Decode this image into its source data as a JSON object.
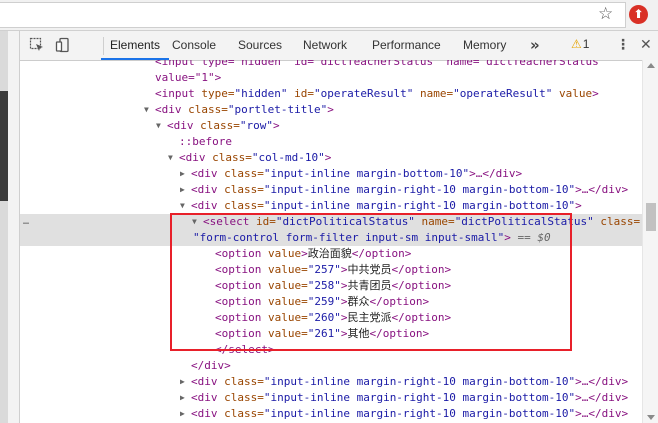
{
  "browser": {
    "star_icon": "star-icon",
    "extension_badge": "⬆"
  },
  "devtools": {
    "tabs": [
      {
        "label": "Elements",
        "active": true
      },
      {
        "label": "Console"
      },
      {
        "label": "Sources"
      },
      {
        "label": "Network"
      },
      {
        "label": "Performance"
      },
      {
        "label": "Memory"
      }
    ],
    "more_tabs": "»",
    "warning_count": "1",
    "menu_glyph": "⋮",
    "close_glyph": "✕",
    "colors": {
      "tag": "#881280",
      "attr_name": "#994500",
      "attr_value": "#1a1aa6",
      "highlight_box": "#e8202a",
      "selected_row": "#e0e0e0"
    }
  },
  "dom": {
    "l0": "<input type=\"hidden\" id=\"dictTeacherStatus\" name=\"dictTeacherStatus\"",
    "l1": "value=\"1\">",
    "l2_tag": "<input",
    "l2_an1": " type=",
    "l2_av1": "\"hidden\"",
    "l2_an2": " id=",
    "l2_av2": "\"operateResult\"",
    "l2_an3": " name=",
    "l2_av3": "\"operateResult\"",
    "l2_an4": " value",
    "l2_end": ">",
    "l3_tag": "<div",
    "l3_an": " class=",
    "l3_av": "\"portlet-title\"",
    "l3_end": ">",
    "l4_tag": "<div",
    "l4_an": " class=",
    "l4_av": "\"row\"",
    "l4_end": ">",
    "l5": "::before",
    "l6_tag": "<div",
    "l6_an": " class=",
    "l6_av": "\"col-md-10\"",
    "l6_end": ">",
    "l7_tag": "<div",
    "l7_an": " class=",
    "l7_av": "\"input-inline margin-bottom-10\"",
    "l7_end": ">…</div>",
    "l8_tag": "<div",
    "l8_an": " class=",
    "l8_av": "\"input-inline margin-right-10 margin-bottom-10\"",
    "l8_end": ">…</div>",
    "l9_tag": "<div",
    "l9_an": " class=",
    "l9_av": "\"input-inline margin-right-10 margin-bottom-10\"",
    "l9_end": ">",
    "l10_tag": "<select",
    "l10_an1": " id=",
    "l10_av1": "\"dictPoliticalStatus\"",
    "l10_an2": " name=",
    "l10_av2": "\"dictPoliticalStatus\"",
    "l10_an3": " class=",
    "l11_av": "\"form-control form-filter input-sm input-small\"",
    "l11_end": ">",
    "l11_eq": " == $0",
    "options": [
      {
        "tag": "<option",
        "attr": " value",
        "val": "",
        "close": ">",
        "text": "政治面貌",
        "end": "</option>"
      },
      {
        "tag": "<option",
        "attr": " value=",
        "val": "\"257\"",
        "close": ">",
        "text": "中共党员",
        "end": "</option>"
      },
      {
        "tag": "<option",
        "attr": " value=",
        "val": "\"258\"",
        "close": ">",
        "text": "共青团员",
        "end": "</option>"
      },
      {
        "tag": "<option",
        "attr": " value=",
        "val": "\"259\"",
        "close": ">",
        "text": "群众",
        "end": "</option>"
      },
      {
        "tag": "<option",
        "attr": " value=",
        "val": "\"260\"",
        "close": ">",
        "text": "民主党派",
        "end": "</option>"
      },
      {
        "tag": "<option",
        "attr": " value=",
        "val": "\"261\"",
        "close": ">",
        "text": "其他",
        "end": "</option>"
      }
    ],
    "l18": "</select>",
    "l19": "</div>",
    "l20_tag": "<div",
    "l20_an": " class=",
    "l20_av": "\"input-inline margin-right-10 margin-bottom-10\"",
    "l20_end": ">…</div>",
    "l21_tag": "<div",
    "l21_an": " class=",
    "l21_av": "\"input-inline margin-right-10 margin-bottom-10\"",
    "l21_end": ">…</div>",
    "l22_tag": "<div",
    "l22_an": " class=",
    "l22_av": "\"input-inline margin-right-10 margin-bottom-10\"",
    "l22_end": ">…</div>",
    "ellipsis": "…"
  }
}
